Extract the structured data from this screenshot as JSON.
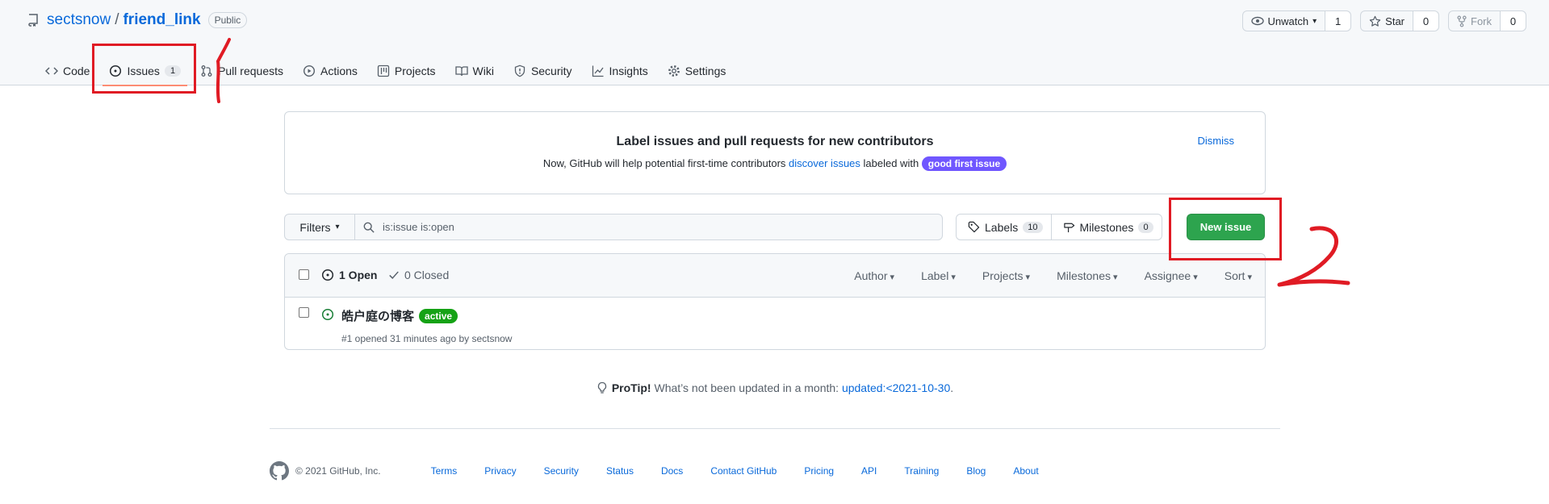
{
  "repo": {
    "owner": "sectsnow",
    "separator": "/",
    "name": "friend_link",
    "visibility": "Public"
  },
  "repo_actions": {
    "watch_label": "Unwatch",
    "watch_count": "1",
    "star_label": "Star",
    "star_count": "0",
    "fork_label": "Fork",
    "fork_count": "0"
  },
  "tabs": [
    {
      "label": "Code",
      "icon": "code-icon"
    },
    {
      "label": "Issues",
      "icon": "issue-opened-icon",
      "counter": "1",
      "selected": true
    },
    {
      "label": "Pull requests",
      "icon": "git-pull-request-icon"
    },
    {
      "label": "Actions",
      "icon": "play-icon"
    },
    {
      "label": "Projects",
      "icon": "table-icon"
    },
    {
      "label": "Wiki",
      "icon": "book-icon"
    },
    {
      "label": "Security",
      "icon": "shield-icon"
    },
    {
      "label": "Insights",
      "icon": "graph-icon"
    },
    {
      "label": "Settings",
      "icon": "gear-icon"
    }
  ],
  "banner": {
    "title": "Label issues and pull requests for new contributors",
    "text_before": "Now, GitHub will help potential first-time contributors ",
    "link": "discover issues",
    "text_after": " labeled with ",
    "label": "good first issue",
    "dismiss": "Dismiss"
  },
  "filter_bar": {
    "filters_label": "Filters",
    "search_value": "is:issue is:open",
    "labels_label": "Labels",
    "labels_count": "10",
    "milestones_label": "Milestones",
    "milestones_count": "0",
    "new_issue_label": "New issue"
  },
  "issues_header": {
    "open": "1 Open",
    "closed": "0 Closed",
    "menus": [
      "Author",
      "Label",
      "Projects",
      "Milestones",
      "Assignee",
      "Sort"
    ]
  },
  "issues": [
    {
      "title": "皓户庭の博客",
      "label": "active",
      "label_color": "#15a215",
      "meta": "#1 opened 31 minutes ago by sectsnow"
    }
  ],
  "protip": {
    "strong": "ProTip!",
    "text": " What’s not been updated in a month: ",
    "link": "updated:<2021-10-30",
    "end": "."
  },
  "footer": {
    "copyright": "© 2021 GitHub, Inc.",
    "links": [
      "Terms",
      "Privacy",
      "Security",
      "Status",
      "Docs",
      "Contact GitHub",
      "Pricing",
      "API",
      "Training",
      "Blog",
      "About"
    ]
  },
  "colors": {
    "primary_button": "#2da44e",
    "link": "#0969da",
    "annotation": "#e01b24",
    "good_first_issue": "#7057ff"
  }
}
